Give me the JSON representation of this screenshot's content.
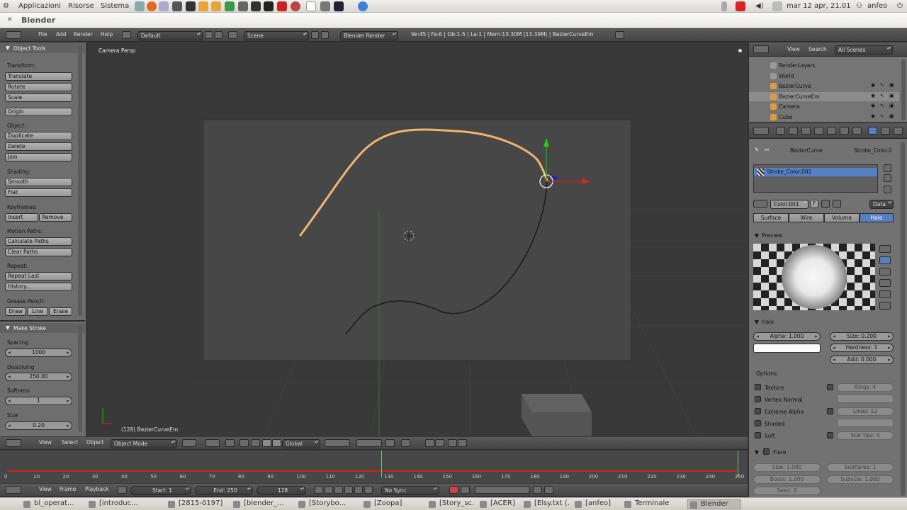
{
  "os_bar": {
    "menus": [
      "Applicazioni",
      "Risorse",
      "Sistema"
    ],
    "clock": "mar 12 apr, 21.01",
    "user": "anfeo"
  },
  "window": {
    "title": "Blender"
  },
  "info_header": {
    "menus": [
      "File",
      "Add",
      "Render",
      "Help"
    ],
    "layout": "Default",
    "scene": "Scene",
    "engine": "Blender Render",
    "stats": "Ve:45 | Fa:6 | Ob:1-5 | La:1 | Mem:13.30M (13.39M) | BezierCurveEm"
  },
  "tool_shelf": {
    "title": "Object Tools",
    "transform_label": "Transform:",
    "transform": [
      "Translate",
      "Rotate",
      "Scale"
    ],
    "origin": "Origin",
    "object_label": "Object:",
    "object": [
      "Duplicate",
      "Delete",
      "Join"
    ],
    "shading_label": "Shading:",
    "shading": [
      "Smooth",
      "Flat"
    ],
    "keyframes_label": "Keyframes:",
    "keyframes": [
      "Insert",
      "Remove"
    ],
    "motion_label": "Motion Paths:",
    "motion": [
      "Calculate Paths",
      "Clear Paths"
    ],
    "repeat_label": "Repeat:",
    "repeat": [
      "Repeat Last",
      "History..."
    ],
    "grease_label": "Grease Pencil:",
    "grease": [
      "Draw",
      "Line",
      "Erase"
    ],
    "op_title": "Make Stroke",
    "spacing_label": "Spacing",
    "spacing": "1000",
    "dissolving_label": "Dissolving",
    "dissolving": "250.00",
    "softness_label": "Softness",
    "softness": "1",
    "size_label": "Size",
    "size": "0.20"
  },
  "viewport": {
    "view_name": "Camera Persp",
    "object_label": "(128) BezierCurveEm",
    "header": {
      "menus": [
        "View",
        "Select",
        "Object"
      ],
      "mode": "Object Mode",
      "orientation": "Global"
    }
  },
  "outliner": {
    "menus": [
      "View",
      "Search"
    ],
    "filter": "All Scenes",
    "items": [
      "RenderLayers",
      "World",
      "BezierCurve",
      "BezierCurveEm",
      "Camera",
      "Cube"
    ]
  },
  "properties": {
    "breadcrumb": [
      "BezierCurve",
      "Stroke_Color.0"
    ],
    "material_slot": "Stroke_Color.001",
    "material_field": "Color.001",
    "material_f": "F",
    "data_dd": "Data",
    "tabs": [
      "Surface",
      "Wire",
      "Volume",
      "Halo"
    ],
    "active_tab": "Halo",
    "preview_label": "Preview",
    "halo_label": "Halo",
    "alpha": "Alpha: 1.000",
    "size": "Size: 0.200",
    "hardness": "Hardness: 1",
    "add": "Add: 0.000",
    "options_label": "Options:",
    "options_left": [
      "Texture",
      "Vertex Normal",
      "Extreme Alpha",
      "Shaded",
      "Soft"
    ],
    "rings": "Rings: 4",
    "lines": "Lines: 12",
    "star_tips": "Star tips: 4",
    "flare_label": "Flare",
    "flare_size": "Size: 1.000",
    "flare_subflares": "Subflares: 1",
    "flare_boost": "Boost: 1.000",
    "flare_subsize": "Subsize: 1.000",
    "flare_seed": "Seed: 0"
  },
  "timeline": {
    "menus": [
      "View",
      "Frame",
      "Playback"
    ],
    "start": "Start: 1",
    "end": "End: 250",
    "current": "128",
    "sync": "No Sync",
    "ticks": [
      "0",
      "10",
      "20",
      "30",
      "40",
      "50",
      "60",
      "70",
      "80",
      "90",
      "100",
      "110",
      "120",
      "130",
      "140",
      "150",
      "160",
      "170",
      "180",
      "190",
      "200",
      "210",
      "220",
      "230",
      "240",
      "250"
    ]
  },
  "taskbar": {
    "items": [
      "bl_operat...",
      "[introduc...",
      "[2815-0197]",
      "[blender_...",
      "[Storybo...",
      "[Zoopa]",
      "[Story_sc...",
      "[ACER]",
      "[Elsy.txt (...",
      "[anfeo]",
      "Terminale",
      "Blender"
    ],
    "active": "Blender"
  },
  "colors": {
    "accent": "#5680c2",
    "curve": "#f4b46e",
    "panel": "#727272",
    "viewport": "#393939"
  }
}
